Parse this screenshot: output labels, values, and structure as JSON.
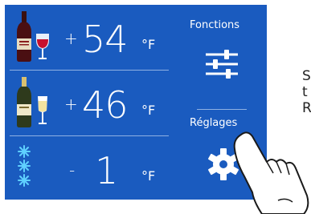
{
  "zones": [
    {
      "name": "wine-red",
      "sign": "+",
      "value": "54",
      "unit": "°F"
    },
    {
      "name": "wine-white",
      "sign": "+",
      "value": "46",
      "unit": "°F"
    },
    {
      "name": "freezer",
      "sign": "-",
      "value": "1",
      "unit": "°F"
    }
  ],
  "sidebar": {
    "functions_label": "Fonctions",
    "settings_label": "Réglages"
  },
  "side_text": [
    "S",
    "t",
    "R"
  ],
  "colors": {
    "panel": "#1a5bbf",
    "divider": "#8fb1e3",
    "text": "#ffffff",
    "snowflake": "#5fd0ff"
  },
  "icons": [
    "wine-bottle-red-icon",
    "wine-glass-red-icon",
    "wine-bottle-white-icon",
    "champagne-glass-icon",
    "snowflake-stack-icon",
    "sliders-icon",
    "gear-icon",
    "pointing-hand-icon"
  ]
}
